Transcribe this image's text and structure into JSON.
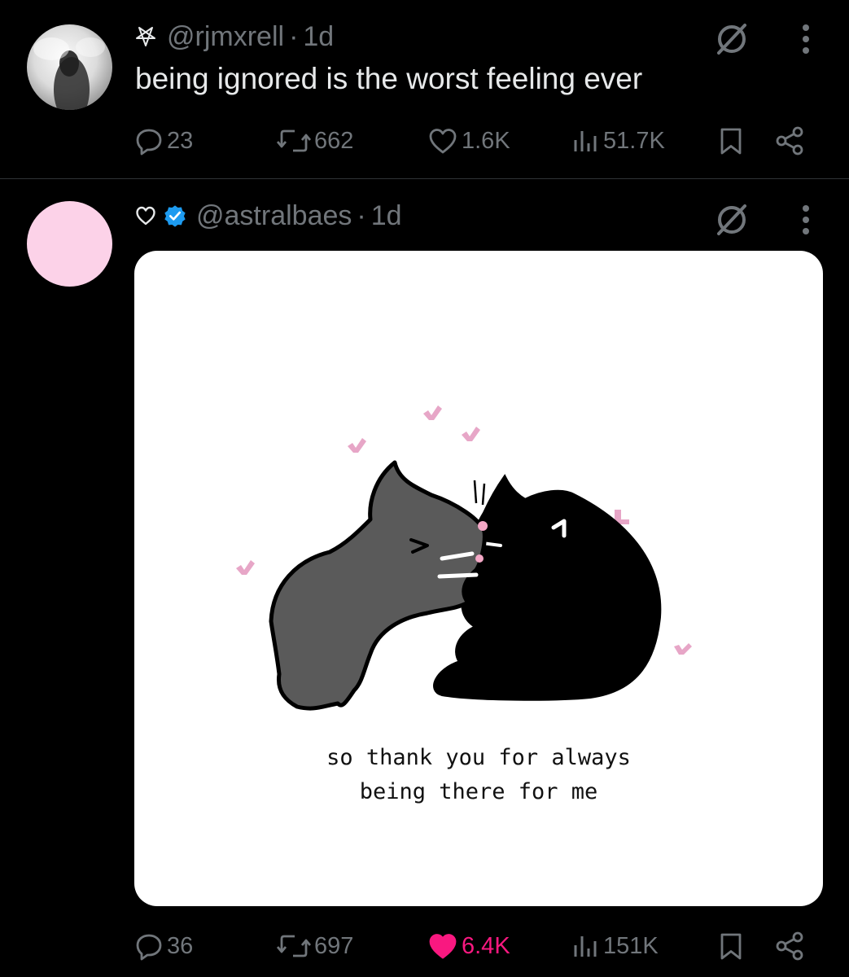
{
  "tweets": [
    {
      "handle": "@rjmxrell",
      "separator": "·",
      "time": "1d",
      "prefix_icon": "pentagram-icon",
      "text": "being ignored is the worst feeling ever",
      "counts": {
        "replies": "23",
        "retweets": "662",
        "likes": "1.6K",
        "views": "51.7K"
      },
      "liked": false
    },
    {
      "handle": "@astralbaes",
      "separator": "·",
      "time": "1d",
      "prefix_icon": "heart-outline-icon",
      "verified": true,
      "image_caption": {
        "line1": "so thank you for always",
        "line2": "being there for me"
      },
      "counts": {
        "replies": "36",
        "retweets": "697",
        "likes": "6.4K",
        "views": "151K"
      },
      "liked": true
    }
  ],
  "colors": {
    "background": "#000000",
    "text_primary": "#e7e9ea",
    "text_secondary": "#71767b",
    "like_pink": "#f91880",
    "verified_blue": "#1d9bf0",
    "avatar_pink": "#fcd2e8",
    "heart_pink": "#e7a6c7"
  }
}
